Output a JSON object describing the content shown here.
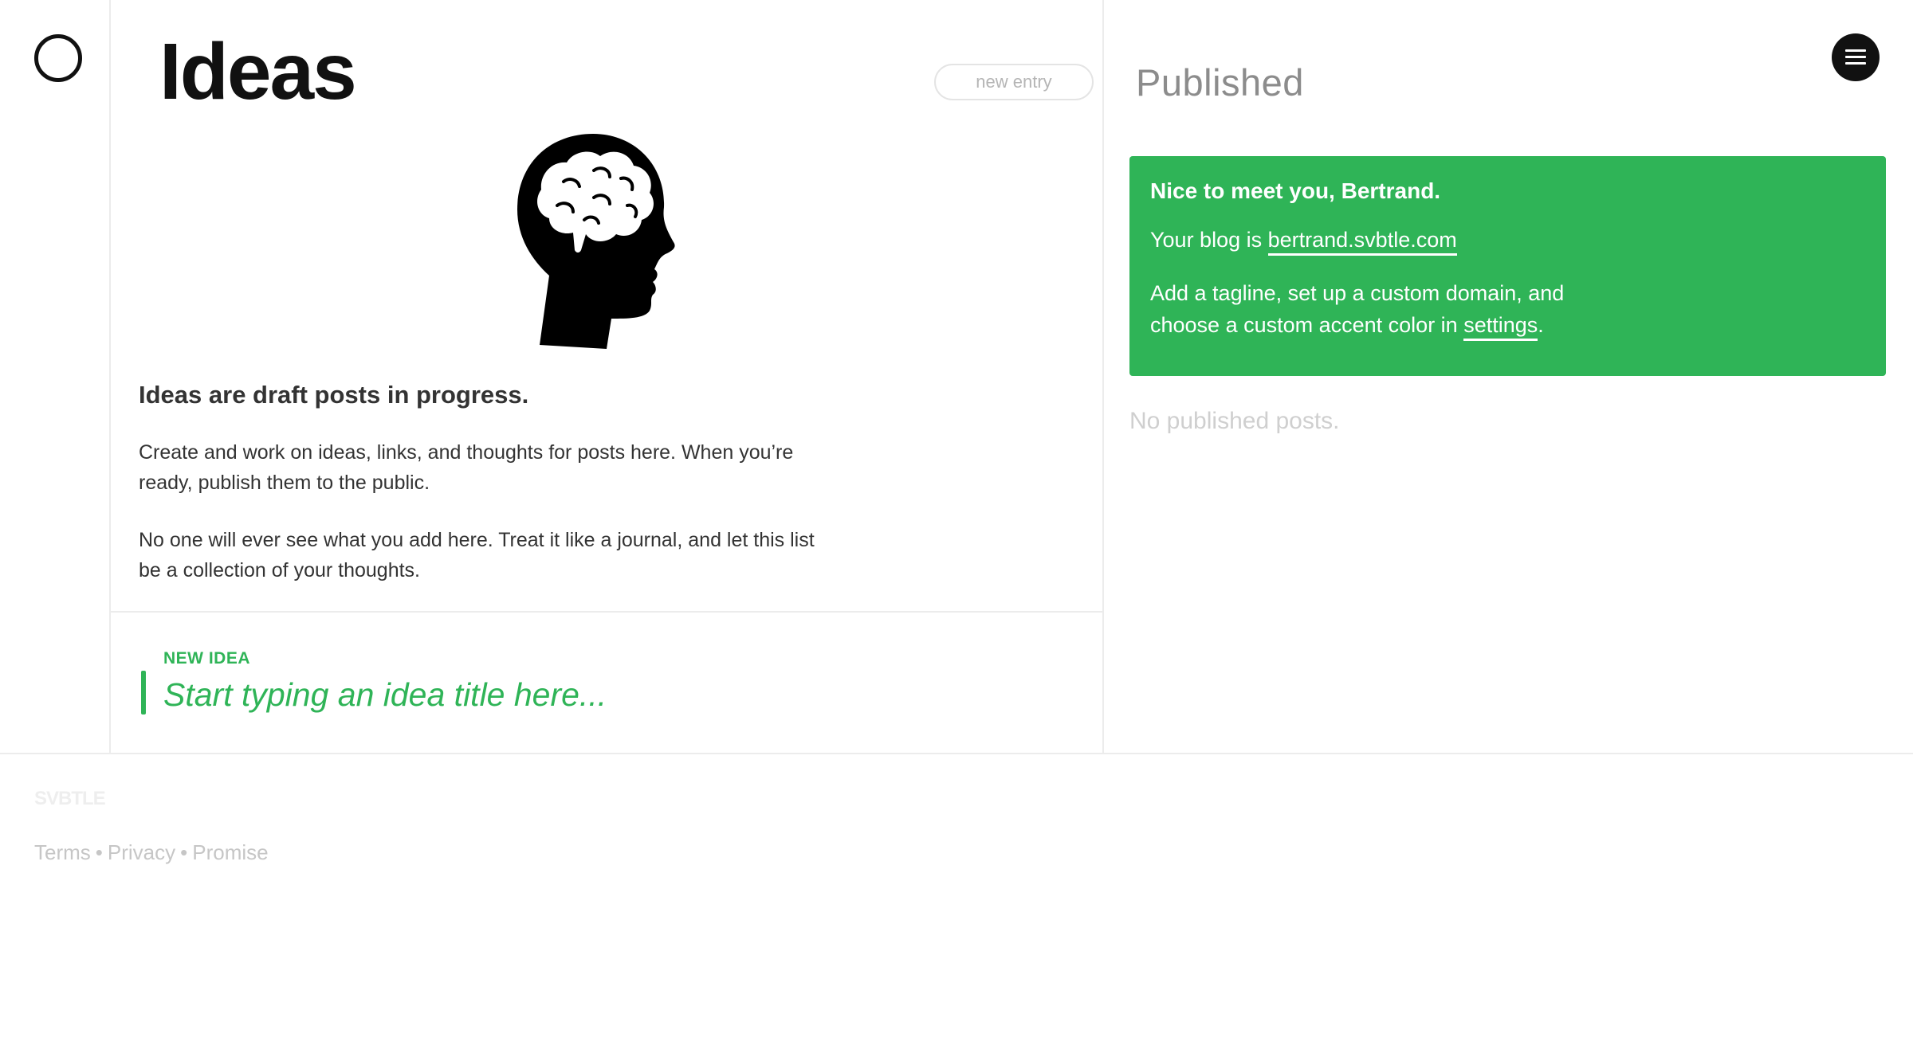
{
  "ideas": {
    "title": "Ideas",
    "new_entry_label": "new entry",
    "intro_heading": "Ideas are draft posts in progress.",
    "intro_paragraph_1": "Create and work on ideas, links, and thoughts for posts here. When you’re ready, publish them to the public.",
    "intro_paragraph_2": "No one will ever see what you add here. Treat it like a journal, and let this list be a collection of your thoughts.",
    "new_idea_label": "NEW IDEA",
    "new_idea_placeholder": "Start typing an idea title here..."
  },
  "published": {
    "title": "Published",
    "welcome": {
      "heading": "Nice to meet you, Bertrand.",
      "blog_prefix": "Your blog is ",
      "blog_link": "bertrand.svbtle.com",
      "custom_text": "Add a tagline, set up a custom domain, and choose a custom accent color in ",
      "settings_link": "settings",
      "custom_suffix": "."
    },
    "empty_text": "No published posts."
  },
  "footer": {
    "brand": "SVBTLE",
    "links": [
      "Terms",
      "Privacy",
      "Promise"
    ],
    "separator": "•"
  },
  "icons": {
    "logo": "circle-logo-icon",
    "menu": "hamburger-menu-icon",
    "illustration": "brain-head-icon"
  },
  "colors": {
    "accent": "#2fb457",
    "text": "#333333",
    "muted": "#8c8c8c"
  }
}
